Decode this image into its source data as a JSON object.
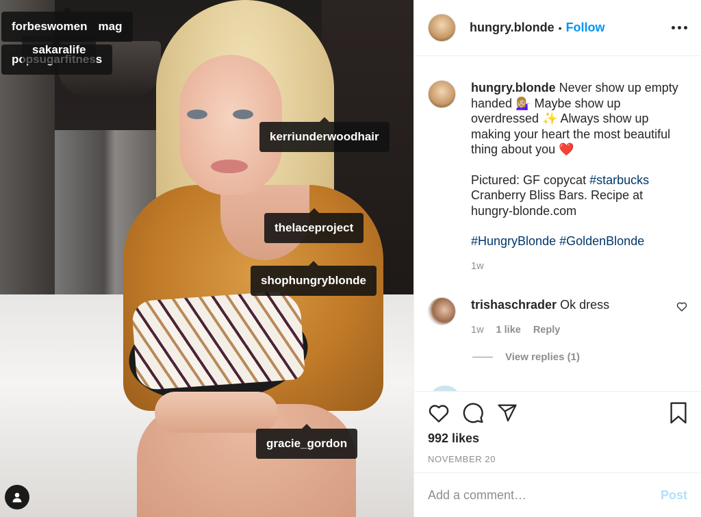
{
  "photo": {
    "tags": {
      "forbeswomen": "forbeswomen",
      "mag": "mag",
      "sakaralife": "sakaralife",
      "popsugarfitness": "popsugarfitness",
      "kerri": "kerriunderwoodhair",
      "lace": "thelaceproject",
      "shop": "shophungryblonde",
      "gracie": "gracie_gordon"
    }
  },
  "header": {
    "username": "hungry.blonde",
    "separator": "•",
    "follow_label": "Follow"
  },
  "caption": {
    "username": "hungry.blonde",
    "line1_text": " Never show up empty handed 💁🏼‍♀️ Maybe show up overdressed ✨ Always show up making your heart the most beautiful thing about you ❤️",
    "line2_prefix": "Pictured: GF copycat ",
    "line2_hashtag": "#starbucks",
    "line2_suffix": " Cranberry Bliss Bars. Recipe at hungry-blonde.com",
    "hashtag1": "#HungryBlonde",
    "hashtag2": "#GoldenBlonde",
    "time": "1w"
  },
  "comment": {
    "username": "trishaschrader",
    "text": " Ok dress",
    "time": "1w",
    "likes": "1 like",
    "reply_label": "Reply",
    "view_replies": "View replies (1)"
  },
  "actions": {
    "likes": "992 likes",
    "date": "NOVEMBER 20"
  },
  "add_comment": {
    "placeholder": "Add a comment…",
    "post_label": "Post"
  },
  "colors": {
    "accent": "#0095f6",
    "hashtag": "#00376b",
    "muted": "#8e8e8e",
    "post_disabled": "#b2dffc"
  }
}
